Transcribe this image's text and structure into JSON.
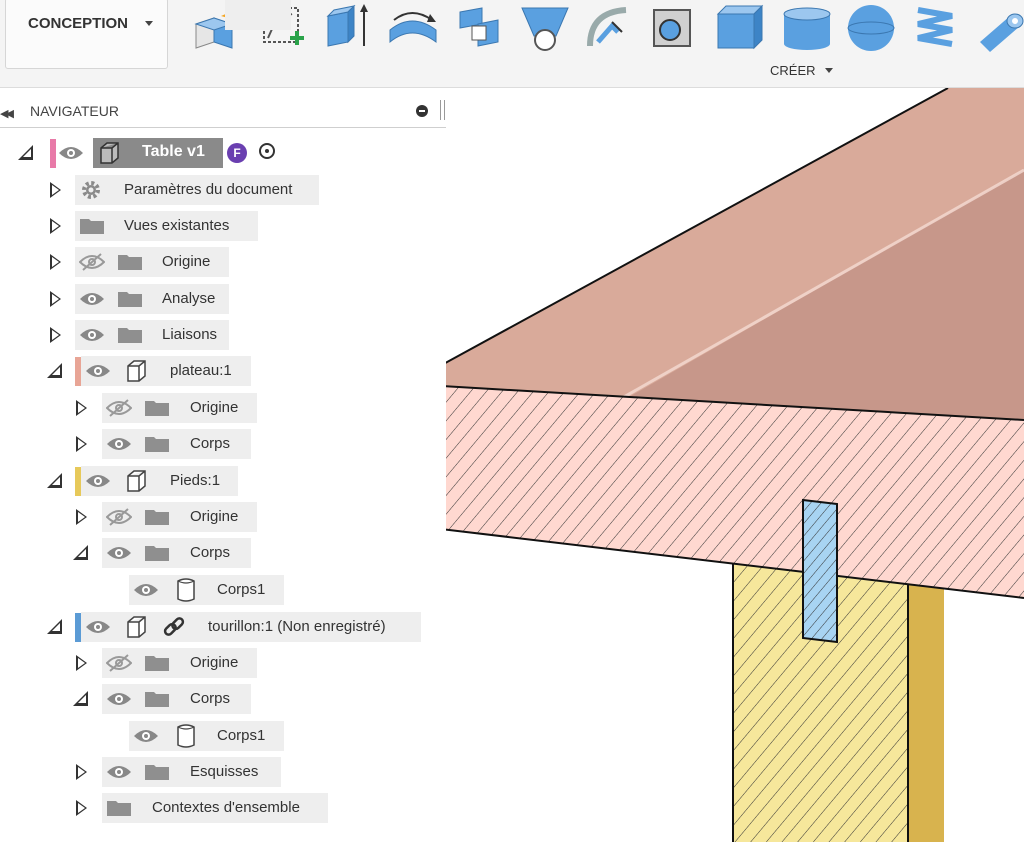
{
  "workspace": {
    "label": "CONCEPTION"
  },
  "toolbar": {
    "group_label": "CRÉER",
    "tools": [
      "new-component-icon",
      "create-sketch-icon",
      "extrude-icon",
      "revolve-icon",
      "sweep-icon",
      "loft-icon",
      "rib-icon",
      "web-icon",
      "hole-icon",
      "box-icon",
      "cylinder-icon",
      "sphere-icon",
      "coil-icon",
      "pipe-icon"
    ]
  },
  "navigator": {
    "title": "NAVIGATEUR",
    "root": {
      "label": "Table v1",
      "badge": "F"
    },
    "items": [
      {
        "label": "Paramètres du document"
      },
      {
        "label": "Vues existantes"
      },
      {
        "label": "Origine"
      },
      {
        "label": "Analyse"
      },
      {
        "label": "Liaisons"
      },
      {
        "label": "plateau:1"
      },
      {
        "label": "Origine"
      },
      {
        "label": "Corps"
      },
      {
        "label": "Pieds:1"
      },
      {
        "label": "Origine"
      },
      {
        "label": "Corps"
      },
      {
        "label": "Corps1"
      },
      {
        "label": "tourillon:1 (Non enregistré)"
      },
      {
        "label": "Origine"
      },
      {
        "label": "Corps"
      },
      {
        "label": "Corps1"
      },
      {
        "label": "Esquisses"
      },
      {
        "label": "Contextes d'ensemble"
      }
    ]
  },
  "colors": {
    "plateau": "#e8a596",
    "pieds": "#e7c95a",
    "tourillon": "#5b9bd5",
    "root": "#e87aa8"
  }
}
